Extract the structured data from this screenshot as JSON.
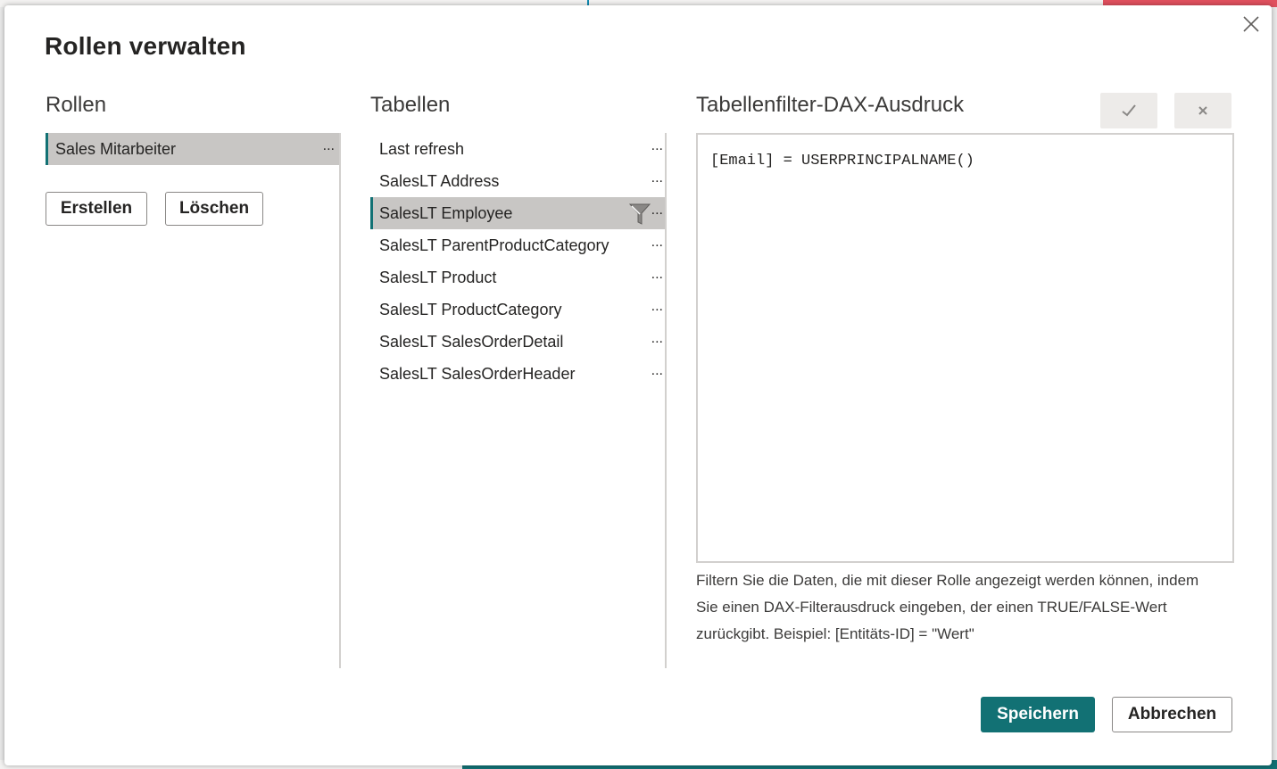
{
  "dialog": {
    "title": "Rollen verwalten"
  },
  "roles": {
    "heading": "Rollen",
    "items": [
      {
        "label": "Sales Mitarbeiter",
        "more": "..."
      }
    ],
    "create_label": "Erstellen",
    "delete_label": "Löschen"
  },
  "tables": {
    "heading": "Tabellen",
    "selected_index": 2,
    "items": [
      {
        "label": "Last refresh",
        "more": "..."
      },
      {
        "label": "SalesLT Address",
        "more": "..."
      },
      {
        "label": "SalesLT Employee",
        "more": "...",
        "has_filter": true
      },
      {
        "label": "SalesLT ParentProductCategory",
        "more": "..."
      },
      {
        "label": "SalesLT Product",
        "more": "..."
      },
      {
        "label": "SalesLT ProductCategory",
        "more": "..."
      },
      {
        "label": "SalesLT SalesOrderDetail",
        "more": "..."
      },
      {
        "label": "SalesLT SalesOrderHeader",
        "more": "..."
      }
    ]
  },
  "dax": {
    "heading": "Tabellenfilter-DAX-Ausdruck",
    "expression": "[Email] = USERPRINCIPALNAME()",
    "help": "Filtern Sie die Daten, die mit dieser Rolle angezeigt werden können, indem Sie einen DAX-Filterausdruck eingeben, der einen TRUE/FALSE-Wert zurückgibt. Beispiel: [Entitäts-ID] = \"Wert\"",
    "confirm_icon": "check-icon",
    "discard_icon": "x-icon"
  },
  "footer": {
    "save_label": "Speichern",
    "cancel_label": "Abbrechen"
  },
  "colors": {
    "accent": "#127174",
    "selected_bg": "#c8c6c4"
  }
}
